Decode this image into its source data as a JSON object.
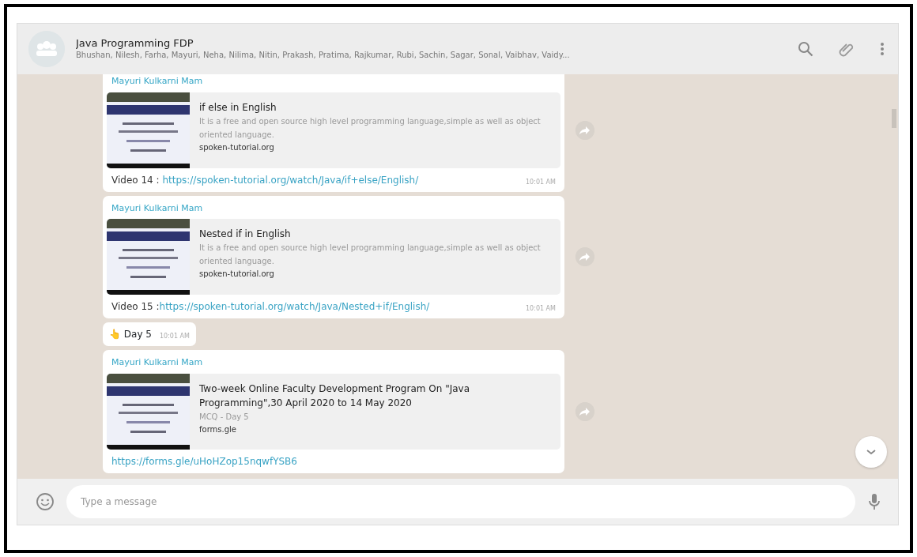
{
  "header": {
    "title": "Java Programming FDP",
    "members": "Bhushan, Nilesh, Farha, Mayuri, Neha, Nilima, Nitin, Prakash, Pratima, Rajkumar, Rubi, Sachin, Sagar, Sonal, Vaibhav, Vaidy..."
  },
  "messages": [
    {
      "kind": "link",
      "sender": "Mayuri Kulkarni Mam",
      "preview_title": "if else in English",
      "preview_description": "It is a free and open source high level programming language,simple as well as object oriented language.",
      "preview_site": "spoken-tutorial.org",
      "text_prefix": "Video 14 : ",
      "url": "https://spoken-tutorial.org/watch/Java/if+else/English/",
      "time": "10:01 AM"
    },
    {
      "kind": "link",
      "sender": "Mayuri Kulkarni Mam",
      "preview_title": "Nested if in English",
      "preview_description": "It is a free and open source high level programming language,simple as well as object oriented language.",
      "preview_site": "spoken-tutorial.org",
      "text_prefix": "Video 15 :",
      "url": "https://spoken-tutorial.org/watch/Java/Nested+if/English/",
      "time": "10:01 AM"
    },
    {
      "kind": "text",
      "emoji": "👆",
      "text": "Day 5",
      "time": "10:01 AM"
    },
    {
      "kind": "link",
      "sender": "Mayuri Kulkarni Mam",
      "preview_title": "Two-week Online Faculty Development Program On \"Java Programming\",30 April 2020 to 14 May 2020",
      "preview_description": "MCQ - Day 5",
      "preview_site": "forms.gle",
      "url": "https://forms.gle/uHoHZop15nqwfYSB6"
    }
  ],
  "composer": {
    "placeholder": "Type a message"
  }
}
